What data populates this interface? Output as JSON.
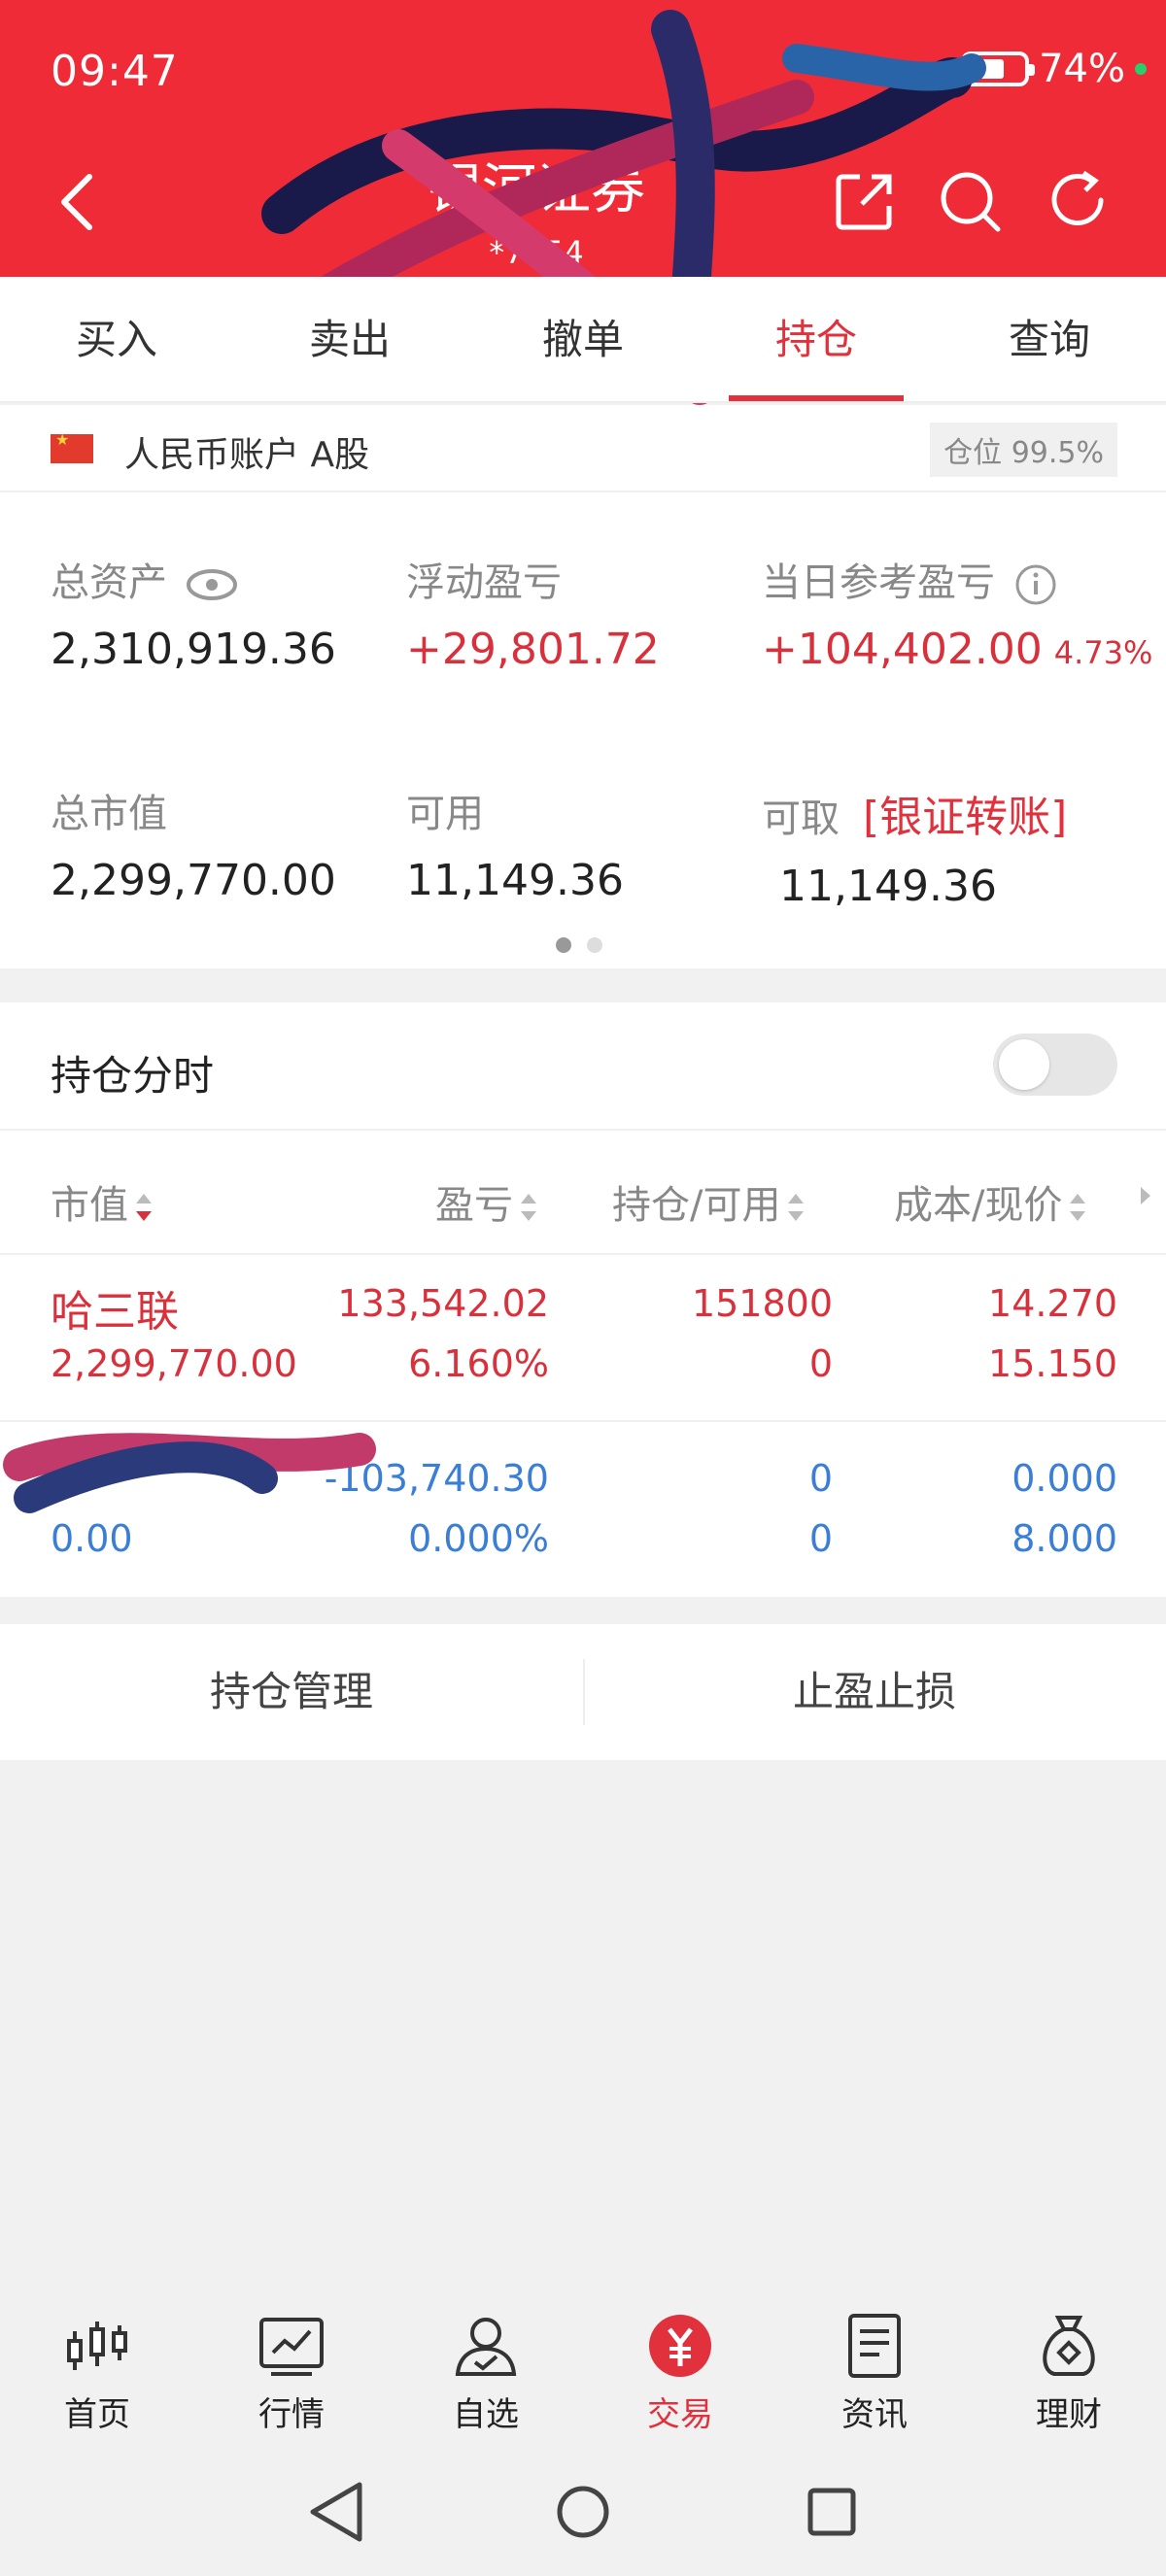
{
  "status": {
    "time": "09:47",
    "battery": "74%"
  },
  "header": {
    "title": "银河证券",
    "account_no": "*7254"
  },
  "tabs": [
    "买入",
    "卖出",
    "撤单",
    "持仓",
    "查询"
  ],
  "active_tab": "持仓",
  "account": {
    "flag_icon": "china-flag-icon",
    "label": "人民币账户 A股",
    "position_ratio": "仓位 99.5%"
  },
  "summary": {
    "total_assets": {
      "label": "总资产",
      "value": "2,310,919.36"
    },
    "floating_pl": {
      "label": "浮动盈亏",
      "value": "+29,801.72"
    },
    "daily_pl": {
      "label": "当日参考盈亏",
      "value": "+104,402.00",
      "pct": "4.73%"
    },
    "market_value": {
      "label": "总市值",
      "value": "2,299,770.00"
    },
    "available": {
      "label": "可用",
      "value": "11,149.36"
    },
    "withdrawable": {
      "label": "可取",
      "value": "11,149.36",
      "link": "[银证转账]"
    }
  },
  "holdings": {
    "title": "持仓分时",
    "columns": [
      "市值",
      "盈亏",
      "持仓/可用",
      "成本/现价"
    ],
    "rows": [
      {
        "name": "哈三联",
        "market_value": "2,299,770.00",
        "pl": "133,542.02",
        "pl_pct": "6.160%",
        "qty": "151800",
        "avail": "0",
        "cost": "14.270",
        "price": "15.150"
      },
      {
        "name": "",
        "market_value": "0.00",
        "pl": "-103,740.30",
        "pl_pct": "0.000%",
        "qty": "0",
        "avail": "0",
        "cost": "0.000",
        "price": "8.000"
      }
    ]
  },
  "actions": {
    "manage": "持仓管理",
    "stop": "止盈止损"
  },
  "bottom_nav": [
    {
      "label": "首页",
      "icon": "candlestick-icon"
    },
    {
      "label": "行情",
      "icon": "chart-icon"
    },
    {
      "label": "自选",
      "icon": "user-check-icon"
    },
    {
      "label": "交易",
      "icon": "yen-icon"
    },
    {
      "label": "资讯",
      "icon": "document-icon"
    },
    {
      "label": "理财",
      "icon": "money-bag-icon"
    }
  ],
  "colors": {
    "brand_red": "#ee2b36",
    "loss_blue": "#3a7fd5",
    "gain_red": "#d9313c"
  }
}
